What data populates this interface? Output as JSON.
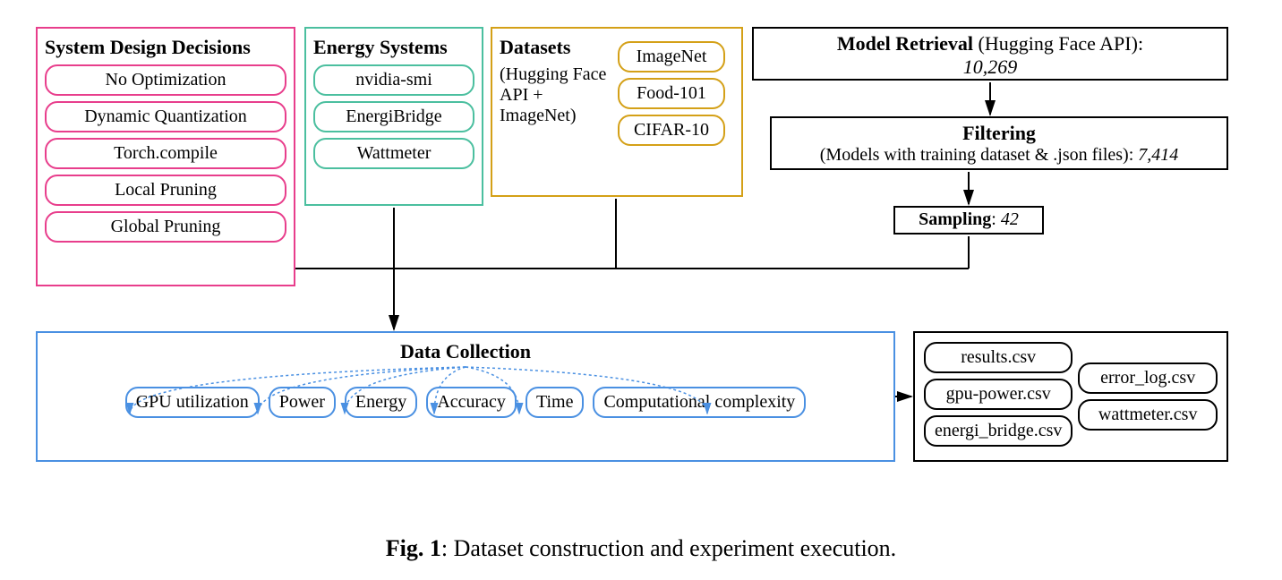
{
  "sys": {
    "title": "System Design Decisions",
    "items": [
      "No Optimization",
      "Dynamic Quantization",
      "Torch.compile",
      "Local Pruning",
      "Global Pruning"
    ]
  },
  "energy": {
    "title": "Energy  Systems",
    "items": [
      "nvidia-smi",
      "EnergiBridge",
      "Wattmeter"
    ]
  },
  "datasets": {
    "title": "Datasets",
    "subtitle": "(Hugging Face API + ImageNet)",
    "items": [
      "ImageNet",
      "Food-101",
      "CIFAR-10"
    ]
  },
  "model_retrieval": {
    "label": "Model Retrieval",
    "paren": " (Hugging Face API):",
    "value": "10,269"
  },
  "filtering": {
    "label": "Filtering",
    "detail": "(Models with training dataset & .json files): ",
    "value": "7,414"
  },
  "sampling": {
    "label": "Sampling",
    "value": "42"
  },
  "data_collection": {
    "title": "Data Collection",
    "metrics": [
      "GPU utilization",
      "Power",
      "Energy",
      "Accuracy",
      "Time",
      "Computational complexity"
    ]
  },
  "outputs": {
    "left": [
      "results.csv",
      "gpu-power.csv",
      "energi_bridge.csv"
    ],
    "right": [
      "error_log.csv",
      "wattmeter.csv"
    ]
  },
  "caption": {
    "fig": "Fig. 1",
    "text": ": Dataset construction and experiment execution."
  }
}
